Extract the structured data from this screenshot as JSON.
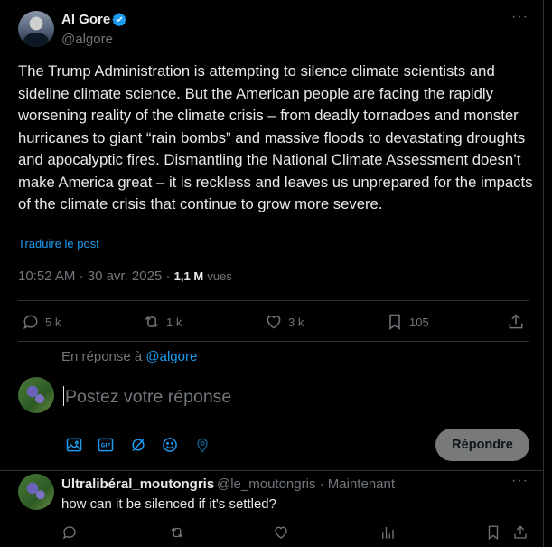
{
  "post": {
    "author_name": "Al Gore",
    "author_handle": "@algore",
    "text": "The Trump Administration is attempting to silence climate scientists and sideline climate science. But the American people are facing the rapidly worsening reality of the climate crisis – from deadly tornadoes and monster hurricanes to giant “rain bombs” and massive floods to devastating droughts and apocalyptic fires. Dismantling the National Climate Assessment doesn’t make America great – it is reckless and leaves us unprepared for the impacts of the climate crisis that continue to grow more severe.",
    "translate_label": "Traduire le post",
    "time": "10:52 AM",
    "date": "30 avr. 2025",
    "separator": "·",
    "views_count": "1,1 M",
    "views_label": "vues",
    "replies": "5 k",
    "reposts": "1 k",
    "likes": "3 k",
    "bookmarks": "105"
  },
  "composer": {
    "reply_to_prefix": "En réponse à",
    "reply_to_handle": "@algore",
    "placeholder": "Postez votre réponse",
    "submit_label": "Répondre"
  },
  "reply": {
    "author_name": "Ultralibéral_moutongris",
    "author_handle": "@le_moutongris",
    "separator": "·",
    "time": "Maintenant",
    "text": "how can it be silenced if it's settled?"
  },
  "icons": [
    "verified-icon",
    "more-icon",
    "reply-icon",
    "repost-icon",
    "like-icon",
    "bookmark-icon",
    "share-icon",
    "image-icon",
    "gif-icon",
    "grok-icon",
    "emoji-icon",
    "location-icon",
    "views-icon"
  ],
  "colors": {
    "background": "#000000",
    "accent": "#1d9bf0",
    "text": "#e7e9ea",
    "muted": "#71767b",
    "border": "#2f3336",
    "button_disabled": "#787a7a"
  }
}
